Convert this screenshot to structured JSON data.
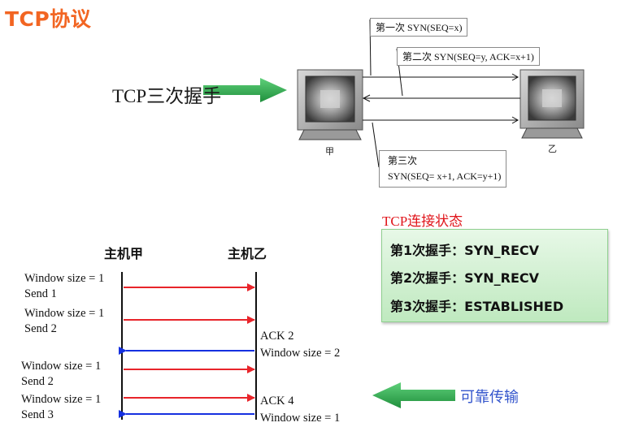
{
  "title": "TCP协议",
  "handshake": {
    "label": "TCP三次握手",
    "host_a": "甲",
    "host_b": "乙",
    "step1": "第一次 SYN(SEQ=x)",
    "step2": "第二次 SYN(SEQ=y, ACK=x+1)",
    "step3_title": "第三次",
    "step3_detail": "SYN(SEQ= x+1, ACK=y+1)"
  },
  "states": {
    "title": "TCP连接状态",
    "items": [
      "第1次握手：SYN_RECV",
      "第2次握手：SYN_RECV",
      "第3次握手：ESTABLISHED"
    ]
  },
  "window_diagram": {
    "host_a": "主机甲",
    "host_b": "主机乙",
    "left_labels": [
      {
        "line1": "Window size = 1",
        "line2": "Send 1"
      },
      {
        "line1": "Window size = 1",
        "line2": "Send 2"
      },
      {
        "line1": "Window size = 1",
        "line2": "Send 2"
      },
      {
        "line1": "Window size = 1",
        "line2": "Send 3"
      }
    ],
    "right_labels": [
      {
        "line1": "ACK 2",
        "line2": "Window size = 2"
      },
      {
        "line1": "ACK 4",
        "line2": "Window size = 1"
      }
    ],
    "caption": "可靠传输"
  },
  "colors": {
    "title": "#f26522",
    "send_arrow": "#e8242a",
    "ack_arrow": "#1530e0",
    "green_arrow": "#2aa84a",
    "state_title": "#e0151b",
    "caption": "#3355cc"
  }
}
